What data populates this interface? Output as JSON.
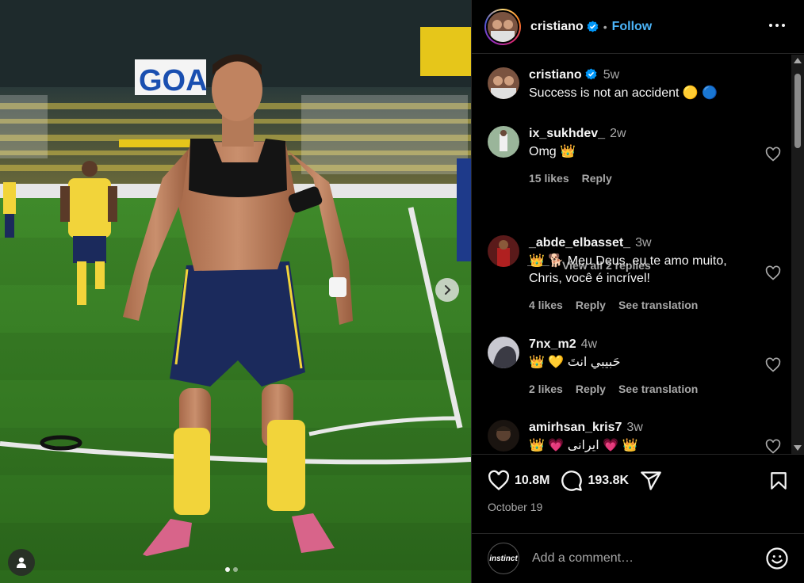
{
  "post": {
    "author": "cristiano",
    "follow_label": "Follow",
    "separator": "•",
    "caption": {
      "author": "cristiano",
      "time": "5w",
      "text": "Success is not an accident 🟡 🔵"
    },
    "media": {
      "banner_text": "GOA",
      "carousel_index": 1,
      "carousel_count": 2
    }
  },
  "comments": [
    {
      "author": "ix_sukhdev_",
      "time": "2w",
      "text": "Omg 👑",
      "likes": "15 likes",
      "reply": "Reply",
      "translate": ""
    },
    {
      "author": "_abde_elbasset_",
      "time": "3w",
      "text": "👑 🐕 Meu Deus, eu te amo muito, Chris, você é incrível!",
      "likes": "4 likes",
      "reply": "Reply",
      "translate": "See translation"
    },
    {
      "author": "7nx_m2",
      "time": "4w",
      "text": "👑 💛 حَبيبي انتَ",
      "likes": "2 likes",
      "reply": "Reply",
      "translate": "See translation"
    },
    {
      "author": "amirhsan_kris7",
      "time": "3w",
      "text": "👑 💗 ایرانی 💗 👑",
      "likes": "",
      "reply": "",
      "translate": ""
    }
  ],
  "view_replies": "View all 2 replies",
  "stats": {
    "likes": "10.8M",
    "comments": "193.8K",
    "date": "October 19"
  },
  "composer": {
    "placeholder": "Add a comment…",
    "avatar_text": "instinct"
  },
  "colors": {
    "link_blue": "#4cb5f9",
    "verified_blue": "#0095f6",
    "muted": "#a8a8a8",
    "jersey_yellow": "#f2d43a",
    "shorts_navy": "#1b2a5c"
  },
  "icons": {
    "more": "more-horizontal-icon",
    "heart": "heart-icon",
    "comment": "comment-icon",
    "share": "share-icon",
    "save": "bookmark-icon",
    "next": "chevron-right-icon",
    "tag": "user-tag-icon",
    "emoji": "emoji-icon"
  }
}
